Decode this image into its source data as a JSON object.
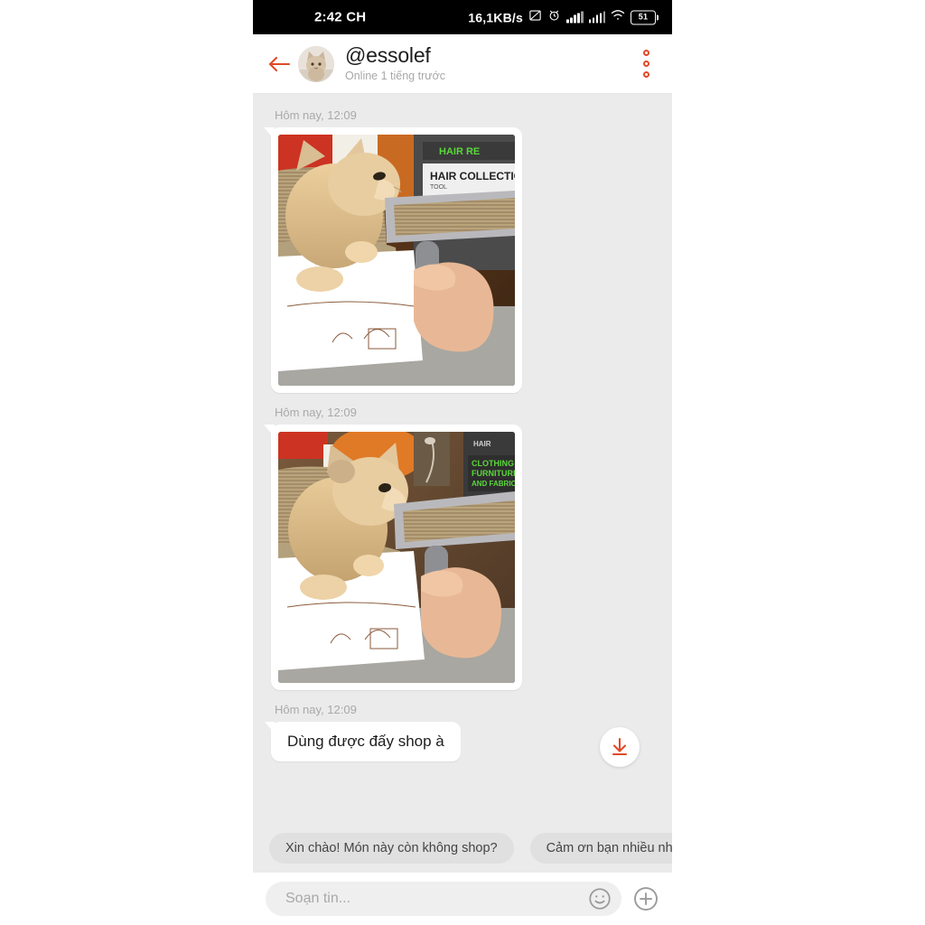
{
  "status_bar": {
    "time": "2:42 CH",
    "network_speed": "16,1KB/s",
    "battery_level": "51",
    "icons": [
      "mute-icon",
      "alarm-icon",
      "signal-bars-icon",
      "signal-bars-icon",
      "wifi-icon",
      "battery-icon"
    ]
  },
  "header": {
    "back_icon": "back-arrow-icon",
    "avatar": "contact-avatar",
    "username": "@essolef",
    "status": "Online 1 tiếng trước",
    "menu_icon": "more-options-icon"
  },
  "conversation": {
    "messages": [
      {
        "timestamp": "Hôm nay, 12:09",
        "type": "image",
        "alt": "cat-with-lint-roller-photo-1"
      },
      {
        "timestamp": "Hôm nay, 12:09",
        "type": "image",
        "alt": "cat-with-lint-roller-photo-2"
      },
      {
        "timestamp": "Hôm nay, 12:09",
        "type": "text",
        "text": "Dùng được đấy shop à"
      }
    ],
    "download_button": "download-icon"
  },
  "quick_replies": [
    "Xin chào! Món này còn không shop?",
    "Cảm ơn bạn nhiều nhé!",
    ""
  ],
  "composer": {
    "placeholder": "Soạn tin...",
    "value": "",
    "emoji_icon": "emoji-icon",
    "attach_icon": "add-attachment-icon"
  },
  "colors": {
    "accent": "#e04a27",
    "chat_background": "#ebebeb",
    "bubble": "#ffffff",
    "chip": "#e0e0e0",
    "status_bar": "#000000"
  }
}
